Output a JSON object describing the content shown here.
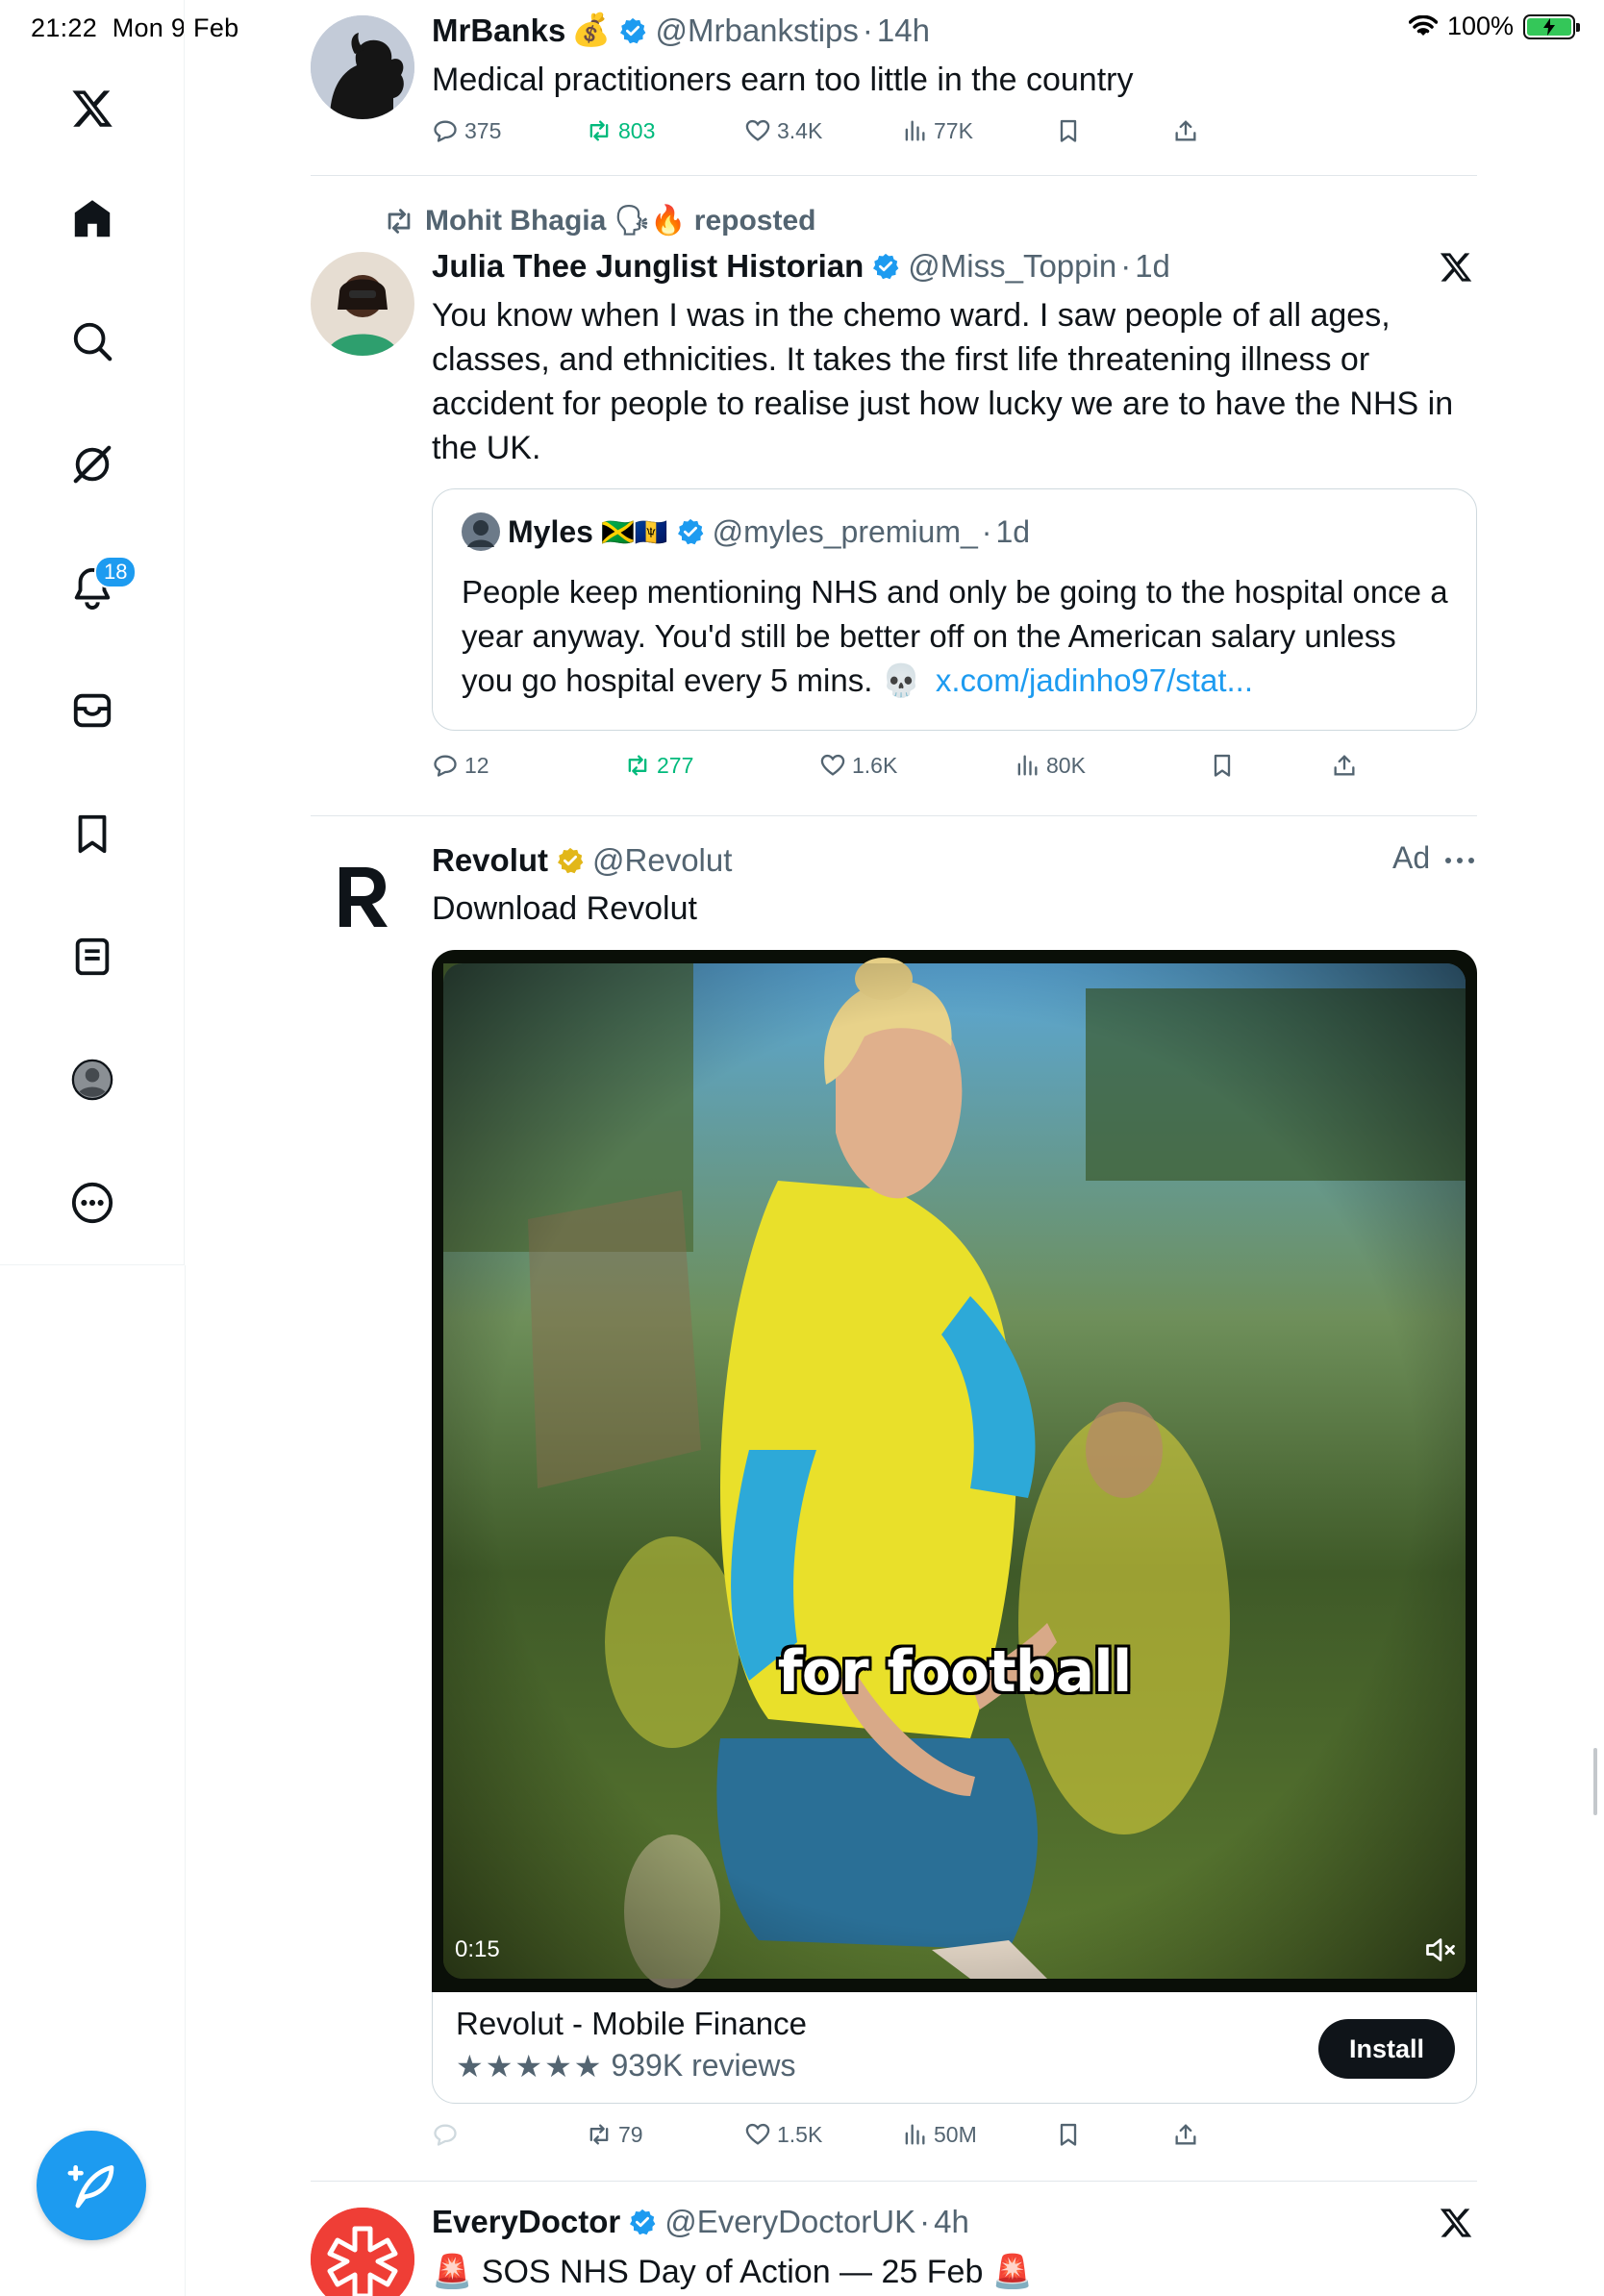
{
  "status_bar": {
    "time": "21:22",
    "date": "Mon 9 Feb",
    "battery": "100%"
  },
  "sidebar": {
    "notifications_badge": "18"
  },
  "tweets": [
    {
      "name": "MrBanks",
      "name_emoji": "💰",
      "handle": "@Mrbankstips",
      "time": "14h",
      "text": "Medical practitioners earn too little in the country",
      "replies": "375",
      "reposts": "803",
      "likes": "3.4K",
      "views": "77K"
    },
    {
      "reposted_by": "Mohit Bhagia",
      "reposted_emoji": "🗣🔥",
      "reposted_label": "reposted",
      "name": "Julia Thee Junglist Historian",
      "handle": "@Miss_Toppin",
      "time": "1d",
      "text": "You know when I was in the chemo ward. I saw people of all ages, classes, and ethnicities. It takes the first life threatening illness or accident for people to realise just how lucky we are to have the NHS in the UK.",
      "quote": {
        "name": "Myles",
        "name_flags": "🇯🇲🇧🇧",
        "handle": "@myles_premium_",
        "time": "1d",
        "text": "People keep mentioning NHS and only be going to the hospital once a year anyway. You'd still be better off on the American salary unless you go hospital every 5 mins. 💀",
        "link": "x.com/jadinho97/stat..."
      },
      "replies": "12",
      "reposts": "277",
      "likes": "1.6K",
      "views": "80K"
    },
    {
      "name": "Revolut",
      "handle": "@Revolut",
      "ad_label": "Ad",
      "text": "Download Revolut",
      "video_caption": "for football",
      "video_time": "0:15",
      "card_title": "Revolut - Mobile Finance",
      "card_stars": "★★★★★",
      "card_reviews": "939K reviews",
      "card_button": "Install",
      "reposts": "79",
      "likes": "1.5K",
      "views": "50M"
    },
    {
      "name": "EveryDoctor",
      "handle": "@EveryDoctorUK",
      "time": "4h",
      "text": "SOS NHS Day of Action — 25 Feb",
      "text_emoji": "🚨"
    }
  ],
  "colors": {
    "accent": "#1d9bf0",
    "repost_green": "#00ba7c",
    "gold_check": "#e2b719"
  }
}
